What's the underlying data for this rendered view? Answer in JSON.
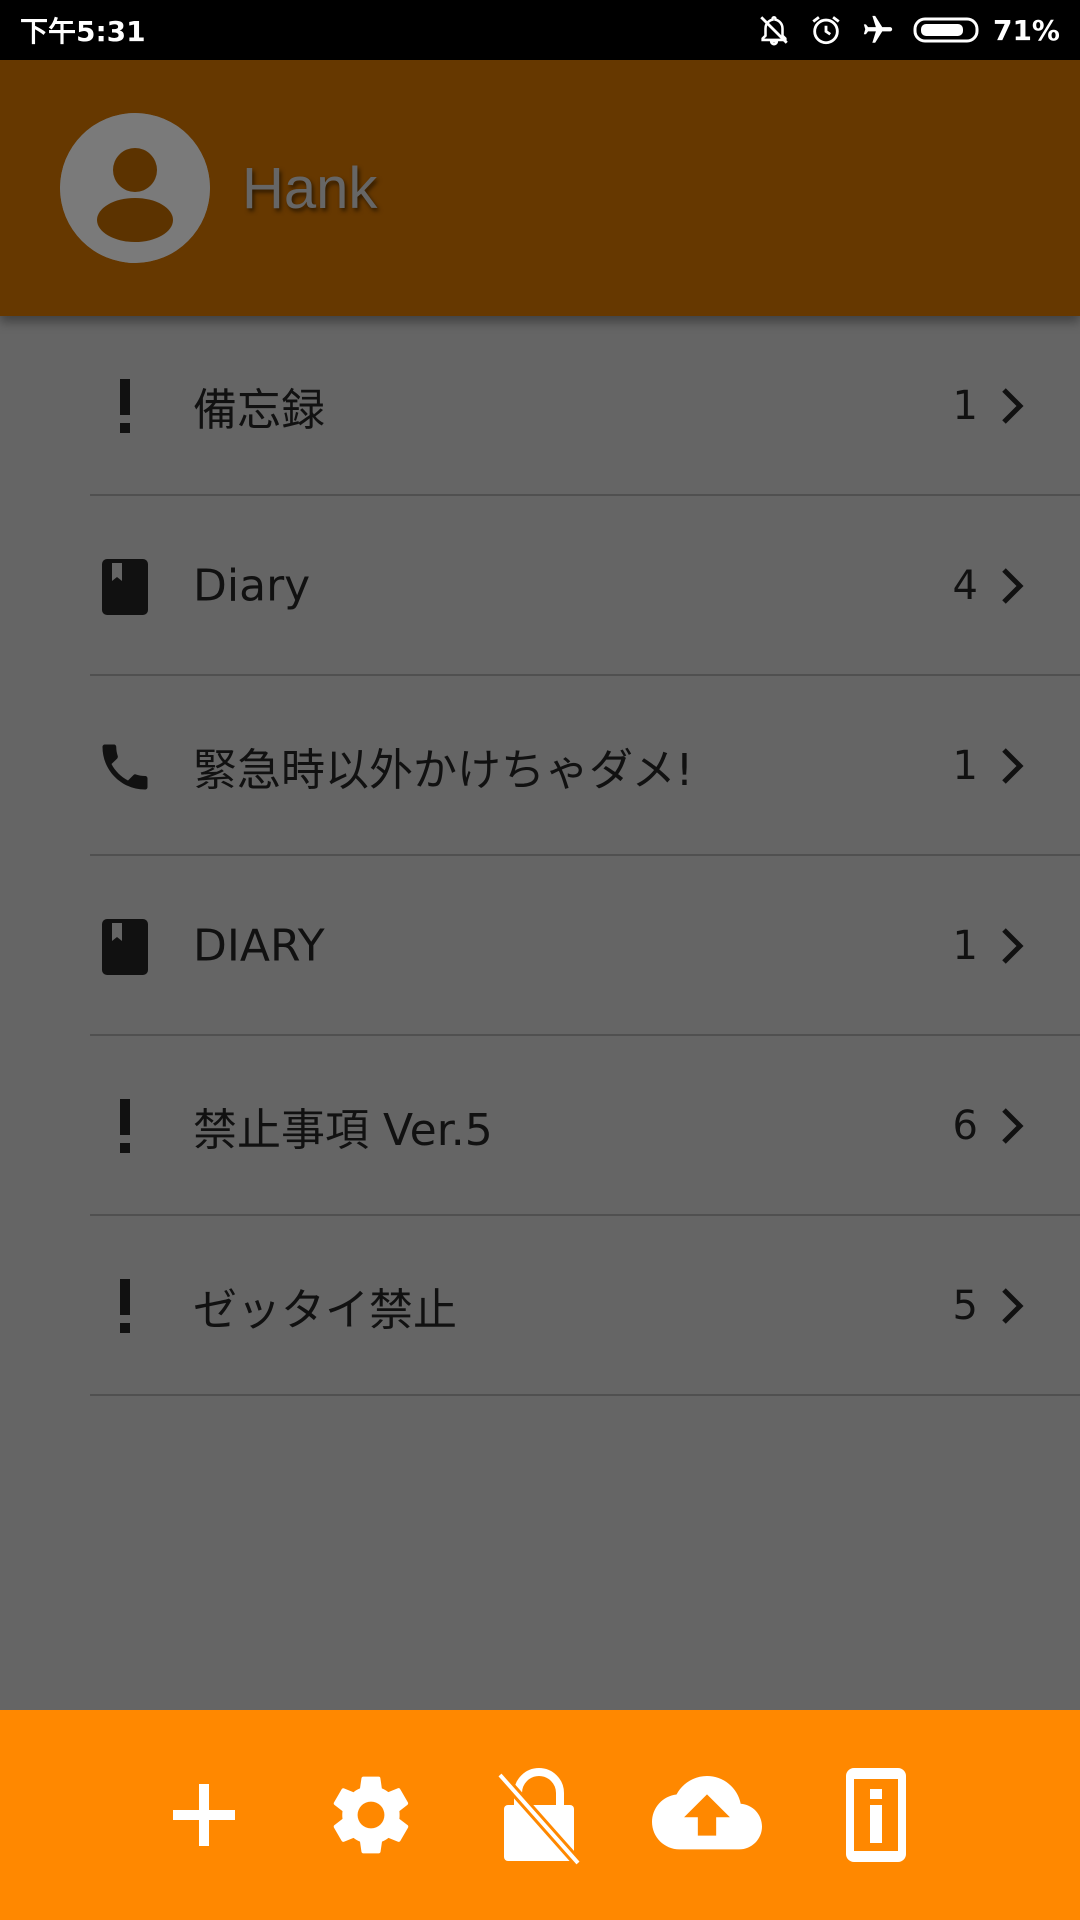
{
  "status_bar": {
    "time": "下午5:31",
    "battery": "71%",
    "icons": [
      "bell-off-icon",
      "alarm-icon",
      "airplane-icon",
      "battery-icon"
    ]
  },
  "header": {
    "username": "Hank",
    "avatar_icon": "person-icon"
  },
  "list": {
    "items": [
      {
        "label": "備忘録",
        "count": "1",
        "icon": "exclamation-icon"
      },
      {
        "label": "Diary",
        "count": "4",
        "icon": "book-icon"
      },
      {
        "label": "緊急時以外かけちゃダメ!",
        "count": "1",
        "icon": "phone-icon"
      },
      {
        "label": "DIARY",
        "count": "1",
        "icon": "book-icon"
      },
      {
        "label": "禁止事項 Ver.5",
        "count": "6",
        "icon": "exclamation-icon"
      },
      {
        "label": "ゼッタイ禁止",
        "count": "5",
        "icon": "exclamation-icon"
      }
    ]
  },
  "bottom_bar": {
    "buttons": [
      "add-icon",
      "settings-icon",
      "unlock-icon",
      "cloud-upload-icon",
      "info-icon"
    ]
  },
  "colors": {
    "header_bg": "#663800",
    "bottom_bar_bg": "#ff8800",
    "list_bg": "#656565"
  }
}
